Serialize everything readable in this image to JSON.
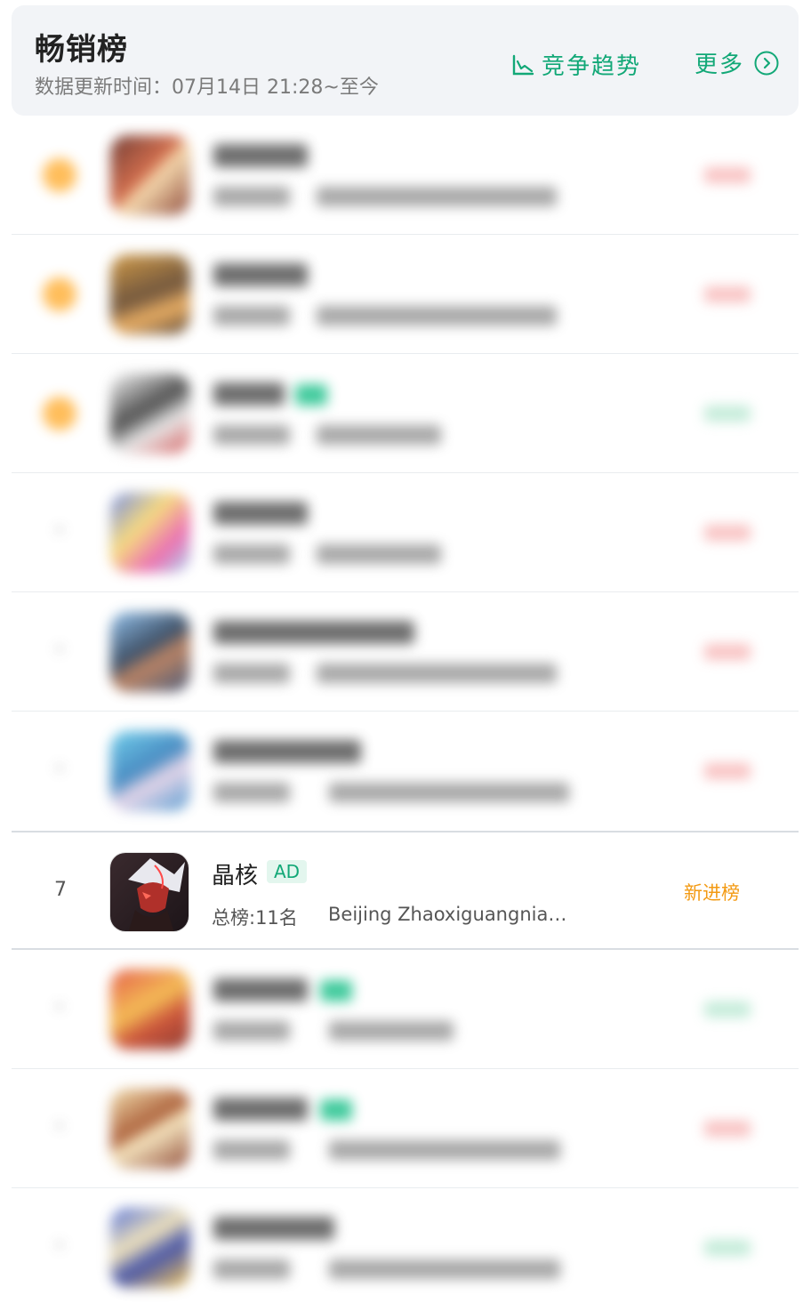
{
  "header": {
    "title": "畅销榜",
    "update_label": "数据更新时间：07月14日 21:28~至今",
    "trend_label": "竞争趋势",
    "more_label": "更多"
  },
  "colors": {
    "accent": "#12a877",
    "new_entry": "#f39a13",
    "ad_badge_bg": "#e3f6ee"
  },
  "featured": {
    "rank": "7",
    "name": "晶核",
    "badge": "AD",
    "total_rank": "总榜:11名",
    "developer": "Beijing Zhaoxiguangnia…",
    "status": "新进榜"
  }
}
